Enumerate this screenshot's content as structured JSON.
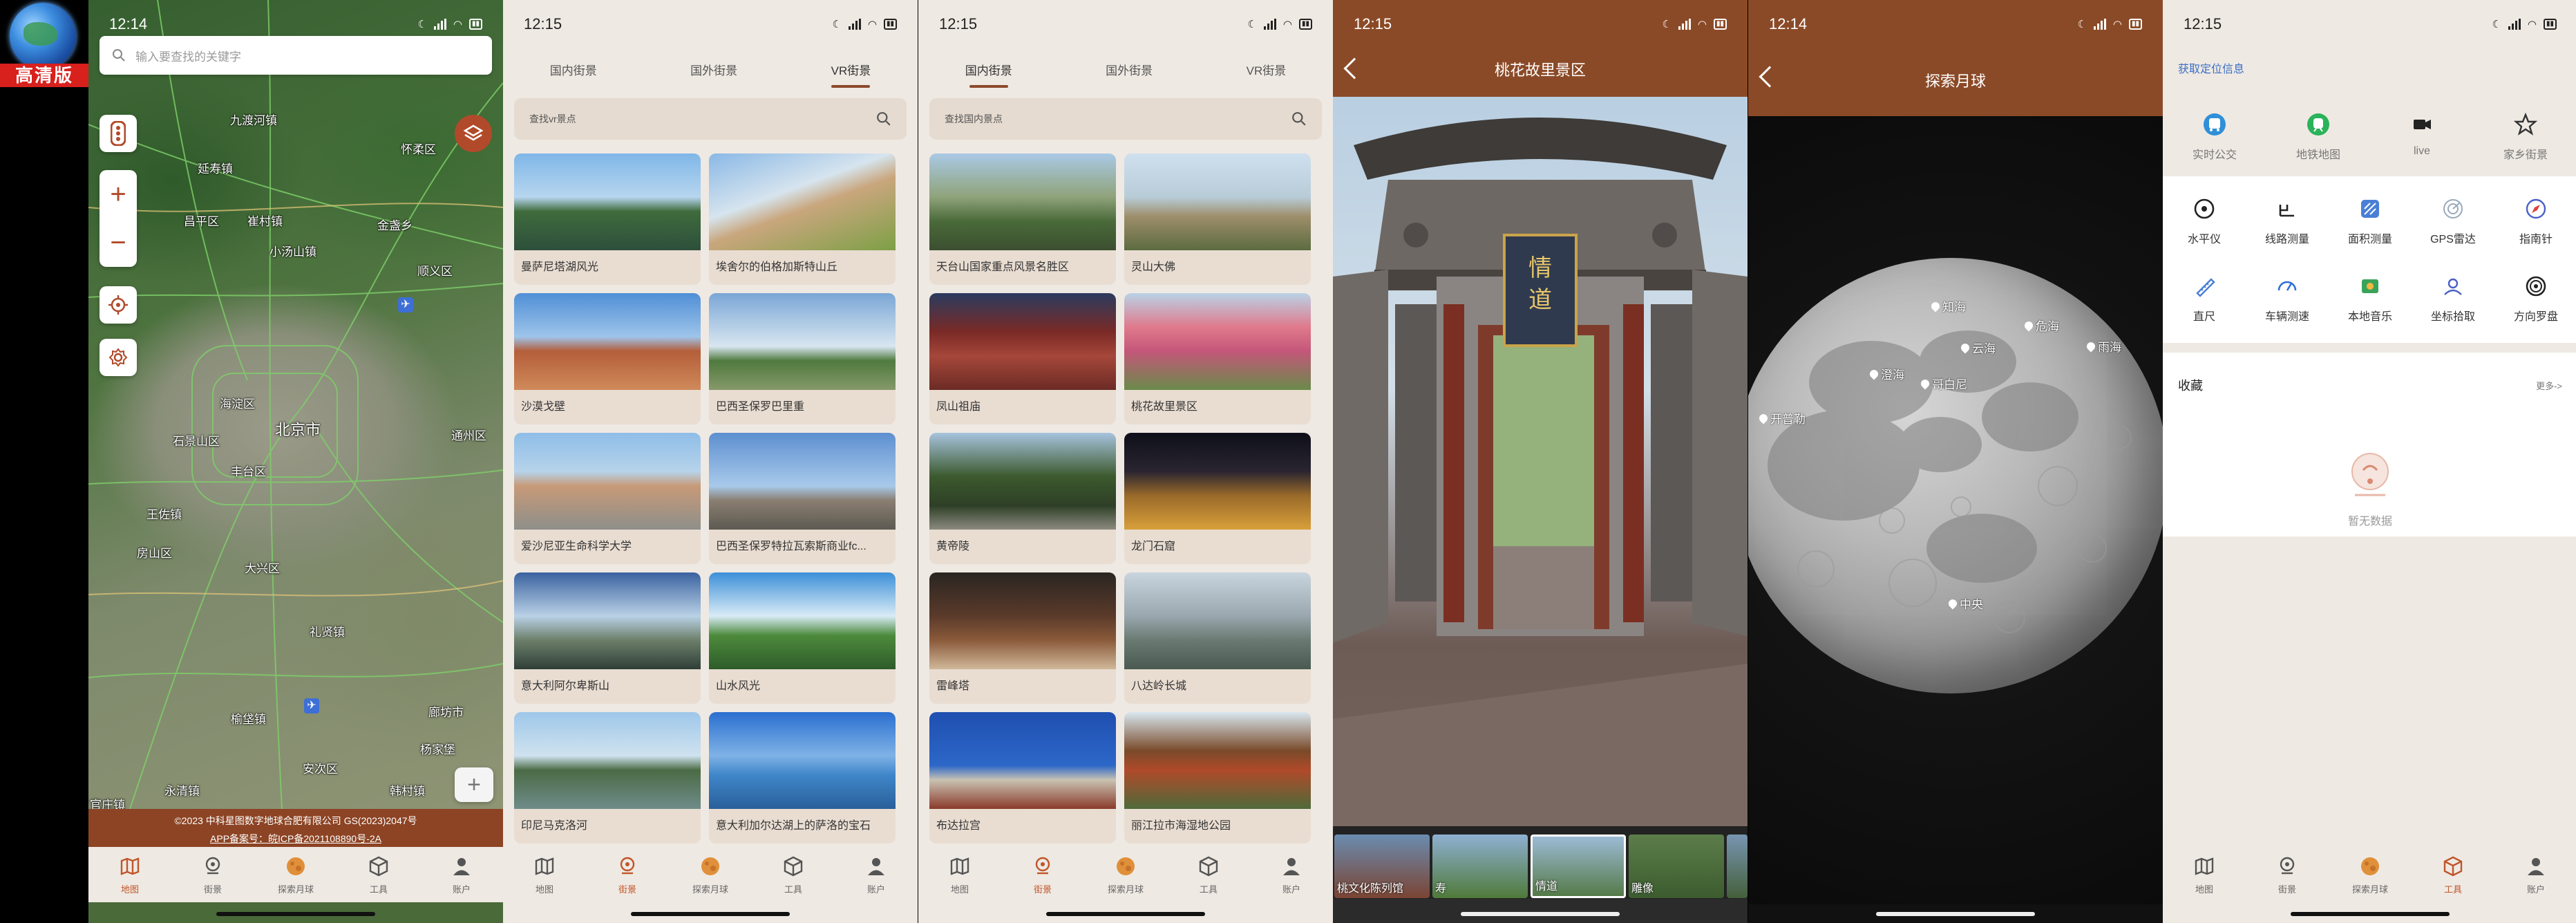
{
  "app_badge": "高清版",
  "colors": {
    "accent": "#8b4a27",
    "active_nav": "#c0562a",
    "link": "#3a6fc5"
  },
  "bottom_nav": [
    {
      "label": "地图",
      "icon": "map-icon"
    },
    {
      "label": "街景",
      "icon": "streetview-icon"
    },
    {
      "label": "探索月球",
      "icon": "moon-icon"
    },
    {
      "label": "工具",
      "icon": "box-icon"
    },
    {
      "label": "账户",
      "icon": "user-icon"
    }
  ],
  "phone1": {
    "time": "12:14",
    "search_placeholder": "输入要查找的关键字",
    "map_labels": [
      {
        "text": "九渡河镇"
      },
      {
        "text": "怀柔区"
      },
      {
        "text": "延寿镇"
      },
      {
        "text": "昌平区"
      },
      {
        "text": "崔村镇"
      },
      {
        "text": "小汤山镇"
      },
      {
        "text": "金盏乡"
      },
      {
        "text": "顺义区"
      },
      {
        "text": "海淀区"
      },
      {
        "text": "石景山区"
      },
      {
        "text": "北京市"
      },
      {
        "text": "通州区"
      },
      {
        "text": "丰台区"
      },
      {
        "text": "房山区"
      },
      {
        "text": "大兴区"
      },
      {
        "text": "榆垡镇"
      },
      {
        "text": "廊坊市"
      },
      {
        "text": "杨家堡"
      },
      {
        "text": "永清镇"
      },
      {
        "text": "官庄镇"
      },
      {
        "text": "韩村镇"
      },
      {
        "text": "王佐镇"
      },
      {
        "text": "礼贤镇"
      },
      {
        "text": "安次区"
      }
    ],
    "copyright_line1": "©2023 中科星图数字地球合肥有限公司 GS(2023)2047号",
    "copyright_line2": "APP备案号：皖ICP备2021108890号-2A",
    "active_nav": 0
  },
  "phone2": {
    "time": "12:15",
    "tabs": [
      "国内街景",
      "国外街景",
      "VR街景"
    ],
    "active_tab": 2,
    "search_placeholder": "查找vr景点",
    "cards": [
      "曼萨尼塔湖风光",
      "埃舍尔的伯格加斯特山丘",
      "沙漠戈壁",
      "巴西圣保罗巴里重",
      "爱沙尼亚生命科学大学",
      "巴西圣保罗特拉瓦索斯商业fc...",
      "意大利阿尔卑斯山",
      "山水风光",
      "印尼马克洛河",
      "意大利加尔达湖上的萨洛的宝石"
    ],
    "active_nav": 1
  },
  "phone3": {
    "time": "12:15",
    "tabs": [
      "国内街景",
      "国外街景",
      "VR街景"
    ],
    "active_tab": 0,
    "search_placeholder": "查找国内景点",
    "cards": [
      "天台山国家重点风景名胜区",
      "灵山大佛",
      "凤山祖庙",
      "桃花故里景区",
      "黄帝陵",
      "龙门石窟",
      "雷峰塔",
      "八达岭长城",
      "布达拉宫",
      "丽江拉市海湿地公园"
    ],
    "active_nav": 1
  },
  "phone4": {
    "time": "12:15",
    "title": "桃花故里景区",
    "plaque": "情道",
    "thumbs": [
      "桃文化陈列馆",
      "寿",
      "情道",
      "雕像",
      ""
    ]
  },
  "phone5": {
    "time": "12:14",
    "title": "探索月球",
    "labels": [
      {
        "text": "知海"
      },
      {
        "text": "澄海"
      },
      {
        "text": "云海"
      },
      {
        "text": "危海"
      },
      {
        "text": "雨海"
      },
      {
        "text": "哥白尼"
      },
      {
        "text": "开普勒"
      },
      {
        "text": "中央"
      }
    ]
  },
  "phone6": {
    "time": "12:15",
    "locate": "获取定位信息",
    "quick": [
      {
        "label": "实时公交",
        "icon": "bus-icon"
      },
      {
        "label": "地铁地图",
        "icon": "metro-icon"
      },
      {
        "label": "live",
        "icon": "camera-icon"
      },
      {
        "label": "家乡街景",
        "icon": "star-icon"
      }
    ],
    "tools_row1": [
      {
        "label": "水平仪",
        "icon": "level-icon"
      },
      {
        "label": "线路测量",
        "icon": "ruler-line-icon"
      },
      {
        "label": "面积测量",
        "icon": "area-icon"
      },
      {
        "label": "GPS雷达",
        "icon": "radar-icon"
      },
      {
        "label": "指南针",
        "icon": "compass-icon"
      }
    ],
    "tools_row2": [
      {
        "label": "直尺",
        "icon": "ruler-icon"
      },
      {
        "label": "车辆测速",
        "icon": "speedometer-icon"
      },
      {
        "label": "本地音乐",
        "icon": "music-icon"
      },
      {
        "label": "坐标拾取",
        "icon": "coordinate-icon"
      },
      {
        "label": "方向罗盘",
        "icon": "direction-icon"
      }
    ],
    "favorites_title": "收藏",
    "favorites_more": "更多->",
    "favorites_empty": "暂无数据",
    "active_nav": 3
  }
}
